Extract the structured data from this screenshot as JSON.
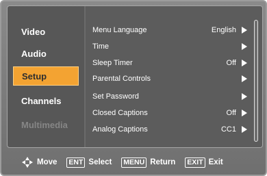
{
  "sidebar": {
    "items": [
      {
        "label": "Video"
      },
      {
        "label": "Audio"
      },
      {
        "label": "Setup"
      },
      {
        "label": "Channels"
      },
      {
        "label": "Multimedia"
      }
    ],
    "selected": "Setup"
  },
  "menu": {
    "rows": [
      {
        "label": "Menu Language",
        "value": "English"
      },
      {
        "label": "Time",
        "value": ""
      },
      {
        "label": "Sleep Timer",
        "value": "Off"
      },
      {
        "label": "Parental Controls",
        "value": ""
      },
      {
        "label": "Set Password",
        "value": ""
      },
      {
        "label": "Closed Captions",
        "value": "Off"
      },
      {
        "label": "Analog Captions",
        "value": "CC1"
      }
    ]
  },
  "footer": {
    "move_label": "Move",
    "select_key": "ENT",
    "select_label": "Select",
    "return_key": "MENU",
    "return_label": "Return",
    "exit_key": "EXIT",
    "exit_label": "Exit"
  },
  "colors": {
    "highlight": "#f3a332",
    "panel": "#5c5c5c",
    "frame": "#7d7d7d"
  }
}
